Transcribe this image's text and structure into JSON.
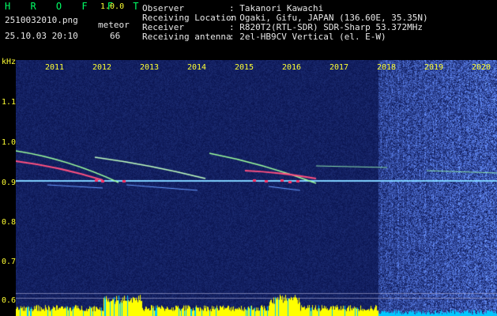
{
  "header": {
    "brand": "H R O F F T",
    "version": "1.0.0",
    "filename": "2510032010.png",
    "meteor_label": "meteor",
    "datetime": "25.10.03 20:10",
    "meteor_count": "66",
    "info": [
      {
        "label": "Observer",
        "value": ": Takanori Kawachi"
      },
      {
        "label": "Receiving Location",
        "value": ": Ogaki, Gifu, JAPAN (136.60E, 35.35N)"
      },
      {
        "label": "Receiver",
        "value": ": R820T2(RTL-SDR) SDR-Sharp 53.372MHz"
      },
      {
        "label": "Receiving antenna",
        "value": ": 2el-HB9CV Vertical (el. E-W)"
      }
    ]
  },
  "y_axis": {
    "unit": "kHz",
    "ticks": [
      "1.1",
      "1.0",
      "0.9",
      "0.8",
      "0.7",
      "0.6"
    ]
  },
  "x_axis": {
    "years": [
      "2011",
      "2012",
      "2013",
      "2014",
      "2015",
      "2016",
      "2017",
      "2018",
      "2019",
      "2020"
    ]
  },
  "colors": {
    "background": "#000000",
    "spectrum_base": "#0a1a6e",
    "carrier_line": "#66ccff",
    "meteor_trace": "#88ff88",
    "hot": "#ff4466",
    "label_yellow": "#ffff33",
    "brand_green": "#00ff66",
    "activity_yellow": "#ffff00",
    "activity_cyan": "#00c8ff"
  }
}
